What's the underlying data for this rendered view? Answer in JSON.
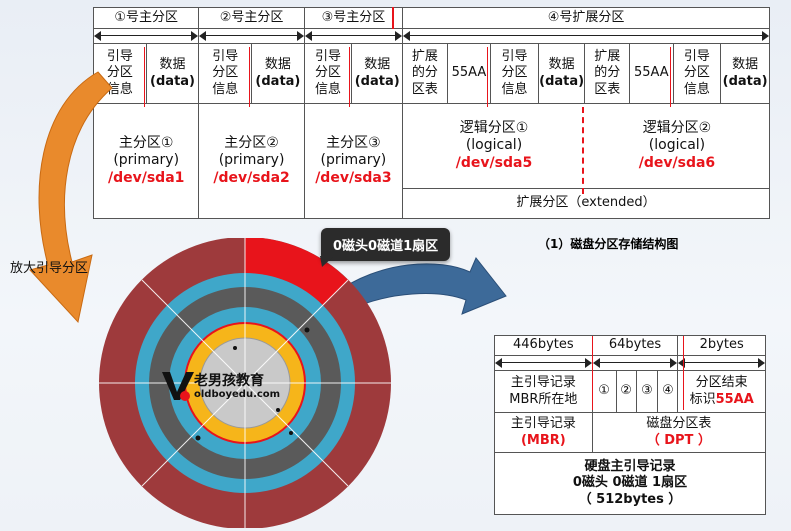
{
  "top_table": {
    "headers": [
      "①号主分区",
      "②号主分区",
      "③号主分区",
      "④号扩展分区"
    ],
    "primary_cells": {
      "boot_info": [
        "引导",
        "分区",
        "信息"
      ],
      "data": [
        "数据",
        "(data)"
      ]
    },
    "extended_cells": {
      "ext_table": [
        "扩展",
        "的分",
        "区表"
      ],
      "sig": "55AA",
      "boot_info": [
        "引导",
        "分区",
        "信息"
      ],
      "data": [
        "数据",
        "(data)"
      ]
    },
    "primary_partitions": [
      {
        "name": "主分区①",
        "type": "(primary)",
        "dev": "/dev/sda1"
      },
      {
        "name": "主分区②",
        "type": "(primary)",
        "dev": "/dev/sda2"
      },
      {
        "name": "主分区③",
        "type": "(primary)",
        "dev": "/dev/sda3"
      }
    ],
    "logical_partitions": [
      {
        "name": "逻辑分区①",
        "type": "(logical)",
        "dev": "/dev/sda5"
      },
      {
        "name": "逻辑分区②",
        "type": "(logical)",
        "dev": "/dev/sda6"
      }
    ],
    "extended_label": "扩展分区（extended）"
  },
  "caption": "（1）磁盘分区存储结构图",
  "left_label": "放大引导分区",
  "callout": "0磁头0磁道1扇区",
  "logo": {
    "name": "老男孩教育",
    "url": "oldboyedu.com"
  },
  "mbr_table": {
    "sizes": [
      "446bytes",
      "64bytes",
      "2bytes"
    ],
    "mbr_location": [
      "主引导记录",
      "MBR所在地"
    ],
    "slots": [
      "①",
      "②",
      "③",
      "④"
    ],
    "end_mark_line1": "分区结束",
    "end_mark_prefix": "标识",
    "end_mark_value": "55AA",
    "mbr_label": "主引导记录",
    "mbr_abbr": "(MBR)",
    "dpt_label": "磁盘分区表",
    "dpt_abbr": "（ DPT ）",
    "footer": [
      "硬盘主引导记录",
      "0磁头 0磁道 1扇区",
      "（ 512bytes ）"
    ]
  },
  "colors": {
    "accent_red": "#e8141b",
    "ring_outer": "#9e3a3c",
    "ring_blue": "#3fa7c9",
    "ring_dark": "#5a5a5a",
    "ring_yellow": "#f6b51a",
    "hub_gray": "#c9c9c9",
    "arrow_orange": "#e98a2c",
    "arrow_blue": "#3d6a99"
  }
}
